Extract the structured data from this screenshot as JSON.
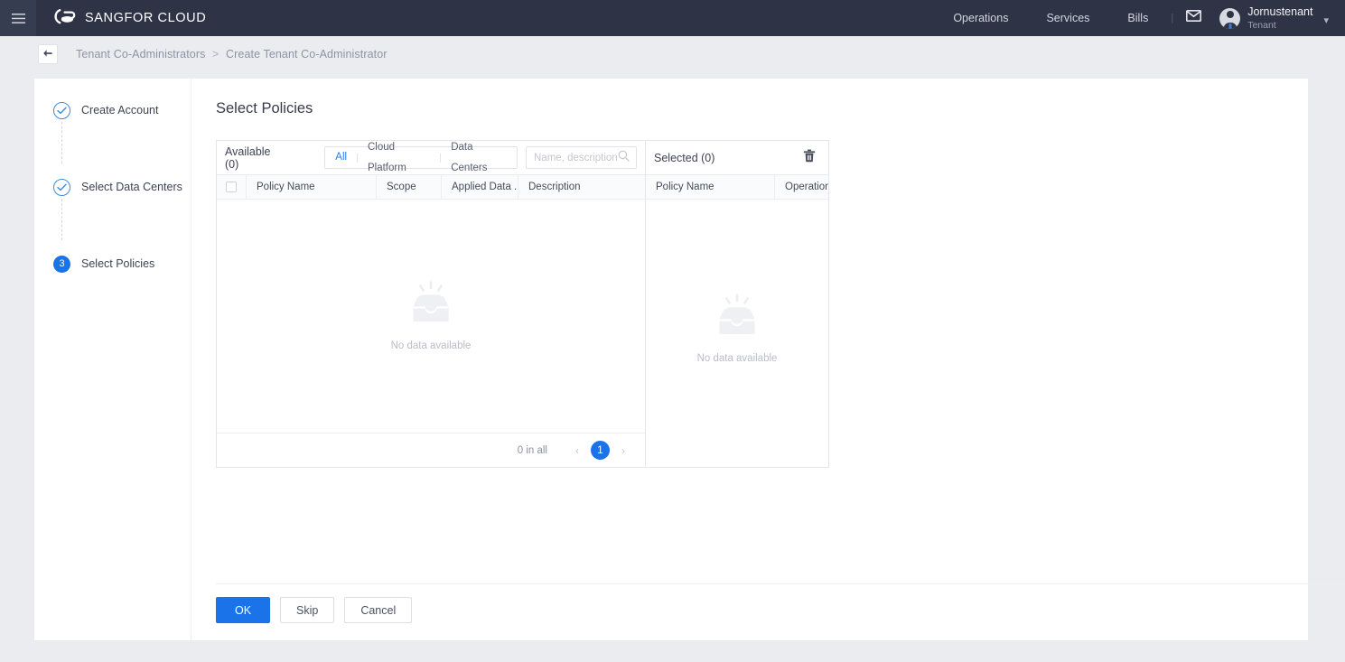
{
  "header": {
    "menu_icon": "hamburger-icon",
    "brand": "SANGFOR CLOUD",
    "brand_icon": "cloud-logo-icon",
    "nav": [
      {
        "label": "Operations"
      },
      {
        "label": "Services"
      },
      {
        "label": "Bills"
      }
    ],
    "separator": "|",
    "mail_icon": "mail-icon",
    "user": {
      "avatar_icon": "user-avatar-icon",
      "name": "Jornustenant",
      "role": "Tenant",
      "caret_icon": "chevron-down-icon"
    }
  },
  "breadcrumb": {
    "back_icon": "back-arrow-icon",
    "parent": "Tenant Co-Administrators",
    "separator": ">",
    "current": "Create Tenant Co-Administrator"
  },
  "steps": [
    {
      "label": "Create Account",
      "state": "done",
      "marker": "✓"
    },
    {
      "label": "Select Data Centers",
      "state": "done",
      "marker": "✓"
    },
    {
      "label": "Select Policies",
      "state": "active",
      "marker": "3"
    }
  ],
  "main": {
    "title": "Select Policies"
  },
  "available": {
    "title": "Available (0)",
    "filters": [
      {
        "label": "All",
        "active": true
      },
      {
        "label": "Cloud Platform",
        "active": false
      },
      {
        "label": "Data Centers",
        "active": false
      }
    ],
    "search": {
      "placeholder": "Name, description",
      "value": "",
      "icon": "search-icon"
    },
    "columns": [
      "Policy Name",
      "Scope",
      "Applied Data ...",
      "Description"
    ],
    "rows": [],
    "empty_text": "No data available",
    "empty_icon": "empty-inbox-icon",
    "footer": {
      "total_text": "0 in all",
      "prev_icon": "chevron-left-icon",
      "page": "1",
      "next_icon": "chevron-right-icon"
    }
  },
  "selected": {
    "title": "Selected (0)",
    "clear_icon": "trash-icon",
    "columns": [
      "Policy Name",
      "Operation"
    ],
    "rows": [],
    "empty_text": "No data available",
    "empty_icon": "empty-inbox-icon"
  },
  "footer_buttons": [
    {
      "label": "OK",
      "kind": "primary"
    },
    {
      "label": "Skip",
      "kind": "ghost"
    },
    {
      "label": "Cancel",
      "kind": "ghost"
    }
  ],
  "colors": {
    "header_bg": "#2e3446",
    "accent": "#1a73e8",
    "page_bg": "#ebecf0",
    "muted_text": "#8c93a3"
  }
}
